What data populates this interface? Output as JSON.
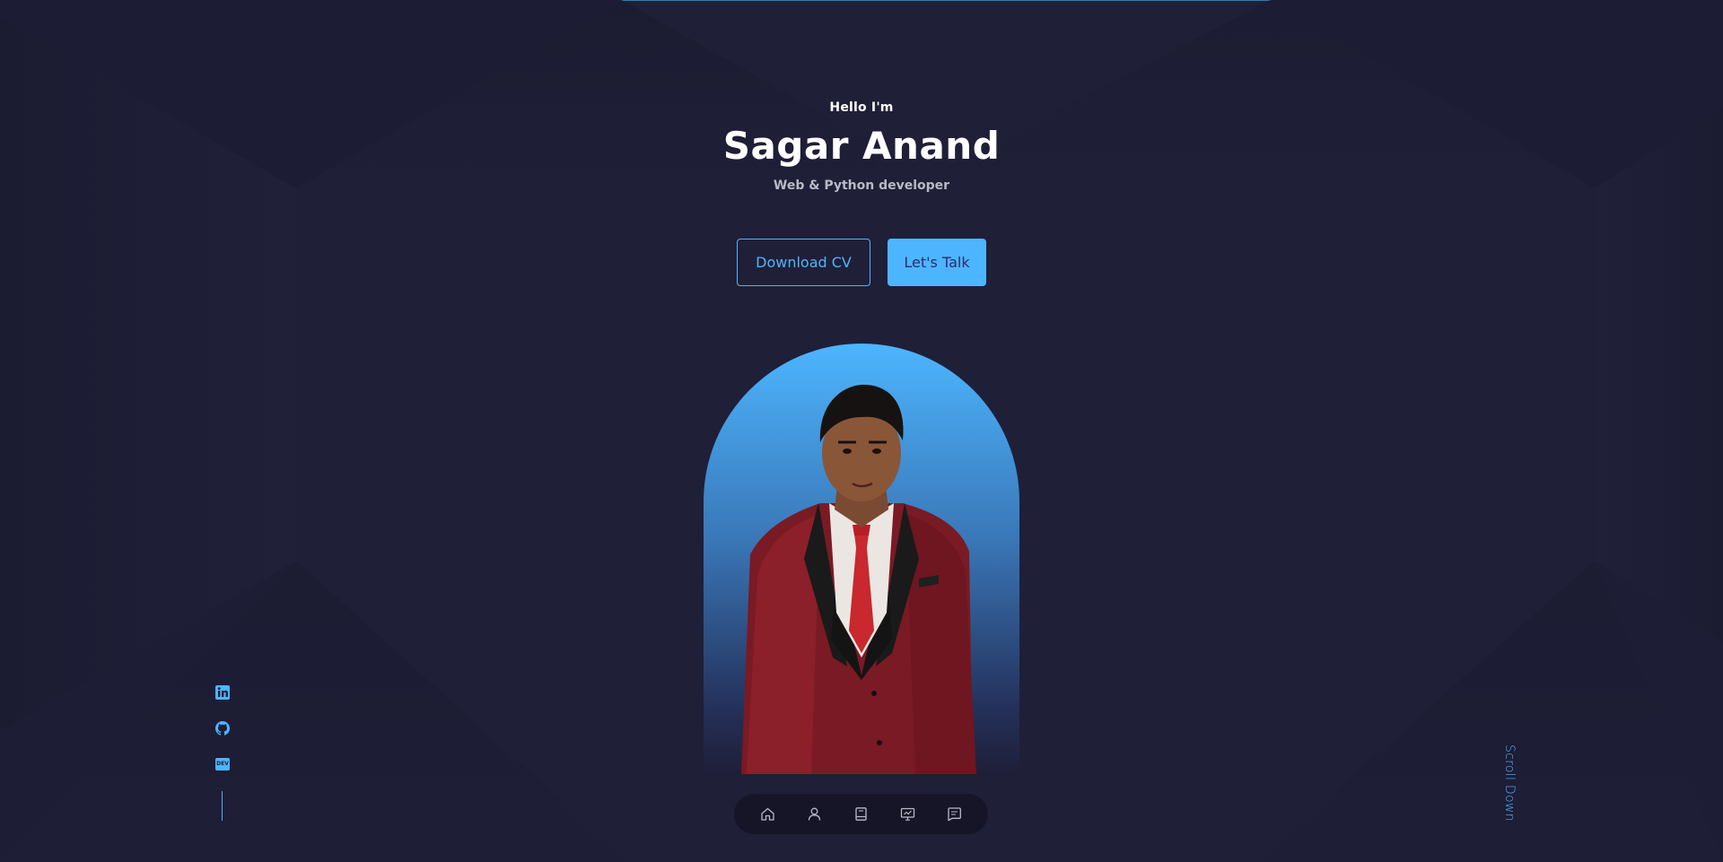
{
  "hero": {
    "greeting": "Hello I'm",
    "name": "Sagar Anand",
    "role": "Web & Python developer"
  },
  "buttons": {
    "download_label": "Download CV",
    "talk_label": "Let's Talk"
  },
  "portrait": {
    "icon": "person-portrait-photo"
  },
  "socials": {
    "items": [
      {
        "icon": "linkedin-icon"
      },
      {
        "icon": "github-icon"
      },
      {
        "icon": "dev-icon",
        "badge": "DEV"
      }
    ]
  },
  "scroll_label": "Scroll Down",
  "nav": {
    "items": [
      {
        "icon": "home-icon"
      },
      {
        "icon": "user-icon"
      },
      {
        "icon": "book-icon"
      },
      {
        "icon": "presentation-icon"
      },
      {
        "icon": "message-icon"
      }
    ]
  },
  "colors": {
    "background": "#1f1f38",
    "primary": "#4db5ff",
    "button_text": "#2c2c6c"
  }
}
